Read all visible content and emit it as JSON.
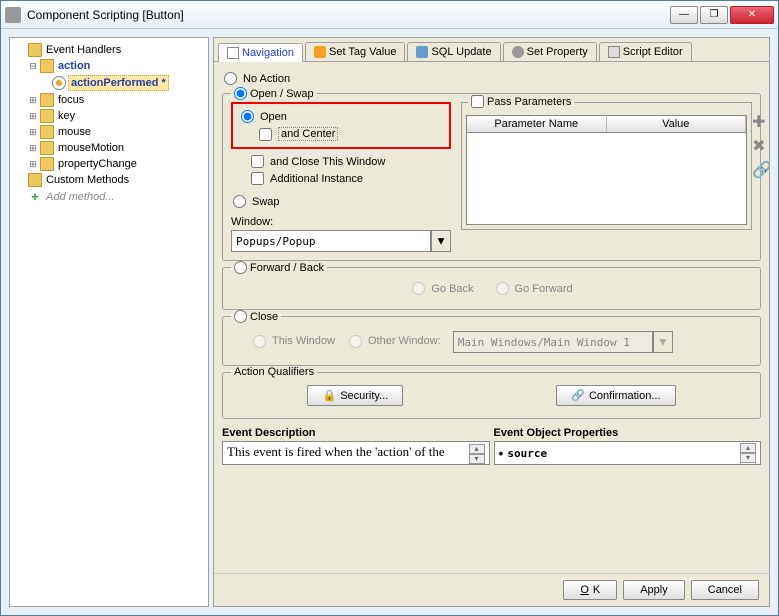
{
  "window": {
    "title": "Component Scripting [Button]"
  },
  "tree": {
    "root": "Event Handlers",
    "action": "action",
    "actionPerformed": "actionPerformed *",
    "focus": "focus",
    "key": "key",
    "mouse": "mouse",
    "mouseMotion": "mouseMotion",
    "propertyChange": "propertyChange",
    "customMethods": "Custom Methods",
    "addMethod": "Add method..."
  },
  "tabs": {
    "navigation": "Navigation",
    "setTagValue": "Set Tag Value",
    "sqlUpdate": "SQL Update",
    "setProperty": "Set Property",
    "scriptEditor": "Script Editor"
  },
  "nav": {
    "noAction": "No Action",
    "openSwap": "Open / Swap",
    "open": "Open",
    "andCenter": "and Center",
    "andCloseThisWindow": "and Close This Window",
    "additionalInstance": "Additional Instance",
    "swap": "Swap",
    "windowLabel": "Window:",
    "windowValue": "Popups/Popup",
    "passParameters": "Pass Parameters",
    "paramName": "Parameter Name",
    "paramValue": "Value",
    "forwardBack": "Forward / Back",
    "goBack": "Go Back",
    "goForward": "Go Forward",
    "close": "Close",
    "thisWindow": "This Window",
    "otherWindow": "Other Window:",
    "otherWindowValue": "Main Windows/Main Window 1",
    "actionQualifiers": "Action Qualifiers",
    "security": "Security...",
    "confirmation": "Confirmation..."
  },
  "bottom": {
    "eventDescription": "Event Description",
    "eventDescText": "This event is fired when the 'action' of the",
    "eventObjectProperties": "Event Object Properties",
    "sourceLabel": "source"
  },
  "footer": {
    "ok": "OK",
    "apply": "Apply",
    "cancel": "Cancel"
  }
}
